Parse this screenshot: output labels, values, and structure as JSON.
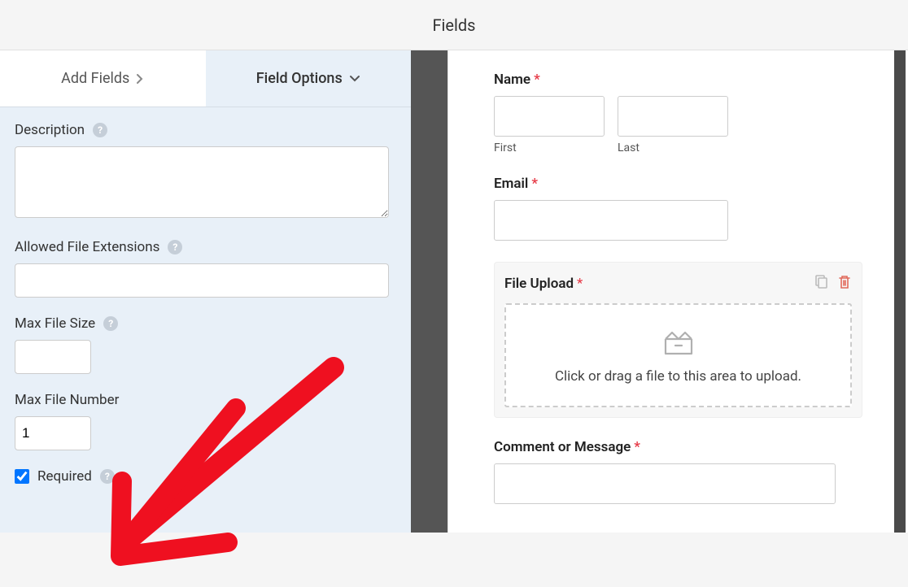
{
  "header": {
    "title": "Fields"
  },
  "tabs": {
    "add_fields": "Add Fields",
    "field_options": "Field Options"
  },
  "left": {
    "description_label": "Description",
    "description_value": "",
    "allowed_ext_label": "Allowed File Extensions",
    "allowed_ext_value": "",
    "max_file_size_label": "Max File Size",
    "max_file_size_value": "",
    "max_file_number_label": "Max File Number",
    "max_file_number_value": "1",
    "required_label": "Required",
    "required_checked": true
  },
  "form": {
    "name_label": "Name",
    "first_sub": "First",
    "last_sub": "Last",
    "email_label": "Email",
    "file_upload_label": "File Upload",
    "upload_hint": "Click or drag a file to this area to upload.",
    "comment_label": "Comment or Message"
  }
}
